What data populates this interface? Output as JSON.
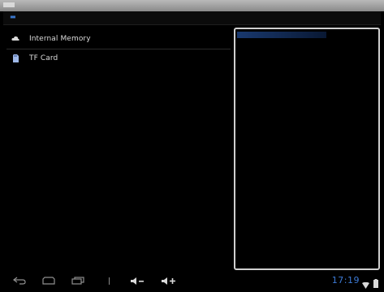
{
  "storage_list": {
    "items": [
      {
        "label": "Internal Memory",
        "icon": "cloud-icon"
      },
      {
        "label": "TF Card",
        "icon": "sd-card-icon"
      }
    ]
  },
  "status_bar": {
    "time": "17:19"
  },
  "colors": {
    "accent": "#3d7bd6",
    "background": "#000000",
    "panel_border": "#cfcfcf"
  }
}
